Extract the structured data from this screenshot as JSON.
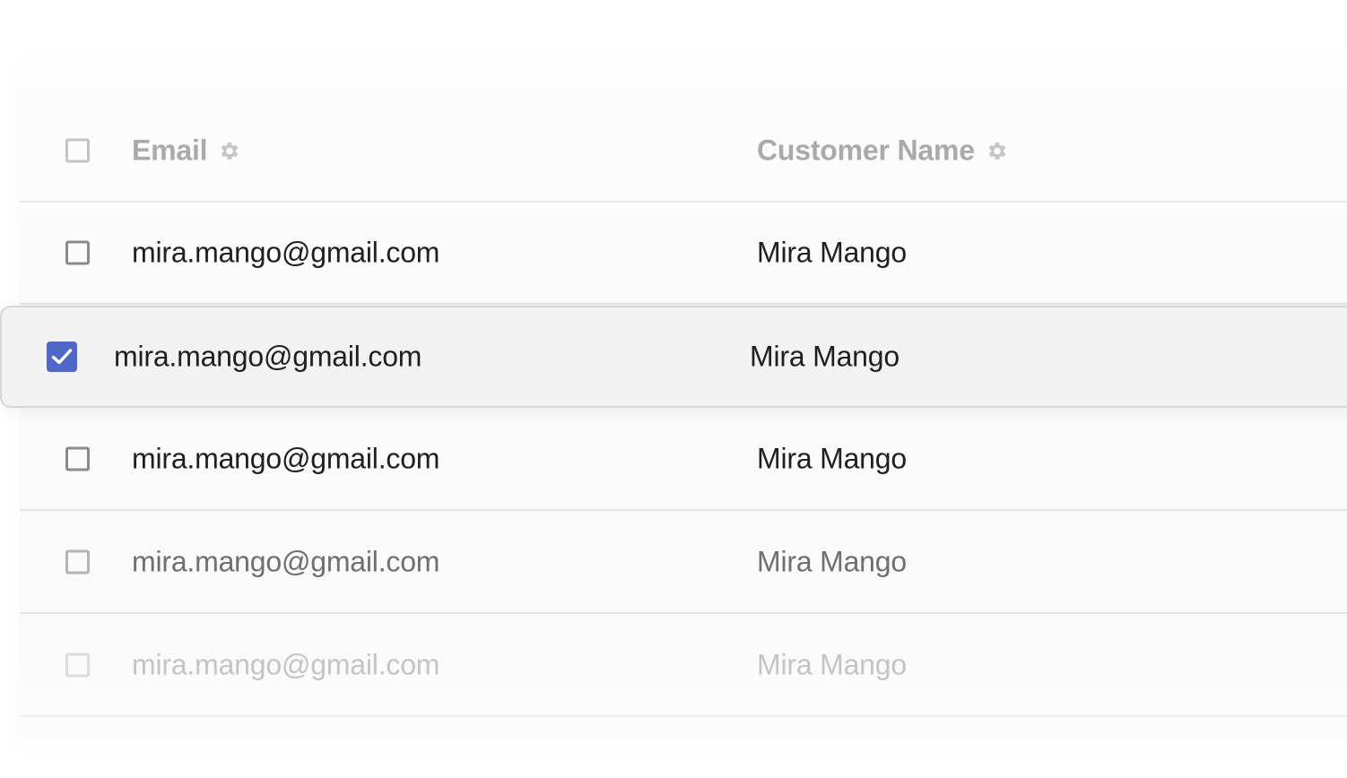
{
  "table": {
    "columns": {
      "email": "Email",
      "customer_name": "Customer Name"
    },
    "header_icons": [
      "gear-icon",
      "gear-icon"
    ],
    "rows": [
      {
        "email": "mira.mango@gmail.com",
        "customer_name": "Mira Mango",
        "checked": false
      },
      {
        "email": "mira.mango@gmail.com",
        "customer_name": "Mira Mango",
        "checked": true
      },
      {
        "email": "mira.mango@gmail.com",
        "customer_name": "Mira Mango",
        "checked": false
      },
      {
        "email": "mira.mango@gmail.com",
        "customer_name": "Mira Mango",
        "checked": false
      },
      {
        "email": "mira.mango@gmail.com",
        "customer_name": "Mira Mango",
        "checked": false
      }
    ]
  },
  "colors": {
    "accent": "#4f67c8",
    "header_text": "#aaaaaa",
    "row_text": "#1f1f1f",
    "divider": "#e6e6e6"
  }
}
